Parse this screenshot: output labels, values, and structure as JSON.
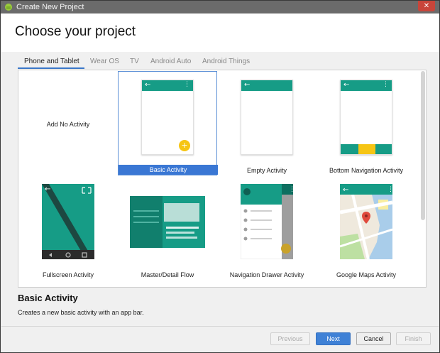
{
  "window": {
    "title": "Create New Project",
    "close_glyph": "✕"
  },
  "header": {
    "title": "Choose your project"
  },
  "tabs": [
    {
      "label": "Phone and Tablet",
      "active": true
    },
    {
      "label": "Wear OS"
    },
    {
      "label": "TV"
    },
    {
      "label": "Android Auto"
    },
    {
      "label": "Android Things"
    }
  ],
  "templates": [
    {
      "label": "Add No Activity"
    },
    {
      "label": "Basic Activity",
      "selected": true
    },
    {
      "label": "Empty Activity"
    },
    {
      "label": "Bottom Navigation Activity"
    },
    {
      "label": "Fullscreen Activity"
    },
    {
      "label": "Master/Detail Flow"
    },
    {
      "label": "Navigation Drawer Activity"
    },
    {
      "label": "Google Maps Activity"
    }
  ],
  "details": {
    "title": "Basic Activity",
    "description": "Creates a new basic activity with an app bar."
  },
  "buttons": {
    "previous": "Previous",
    "next": "Next",
    "cancel": "Cancel",
    "finish": "Finish"
  },
  "glyphs": {
    "back": "←",
    "more": "⋮",
    "fab": "+",
    "expand": "⛶"
  },
  "colors": {
    "primary": "#169c86",
    "accent": "#f6c514",
    "selection": "#3a77d4"
  }
}
